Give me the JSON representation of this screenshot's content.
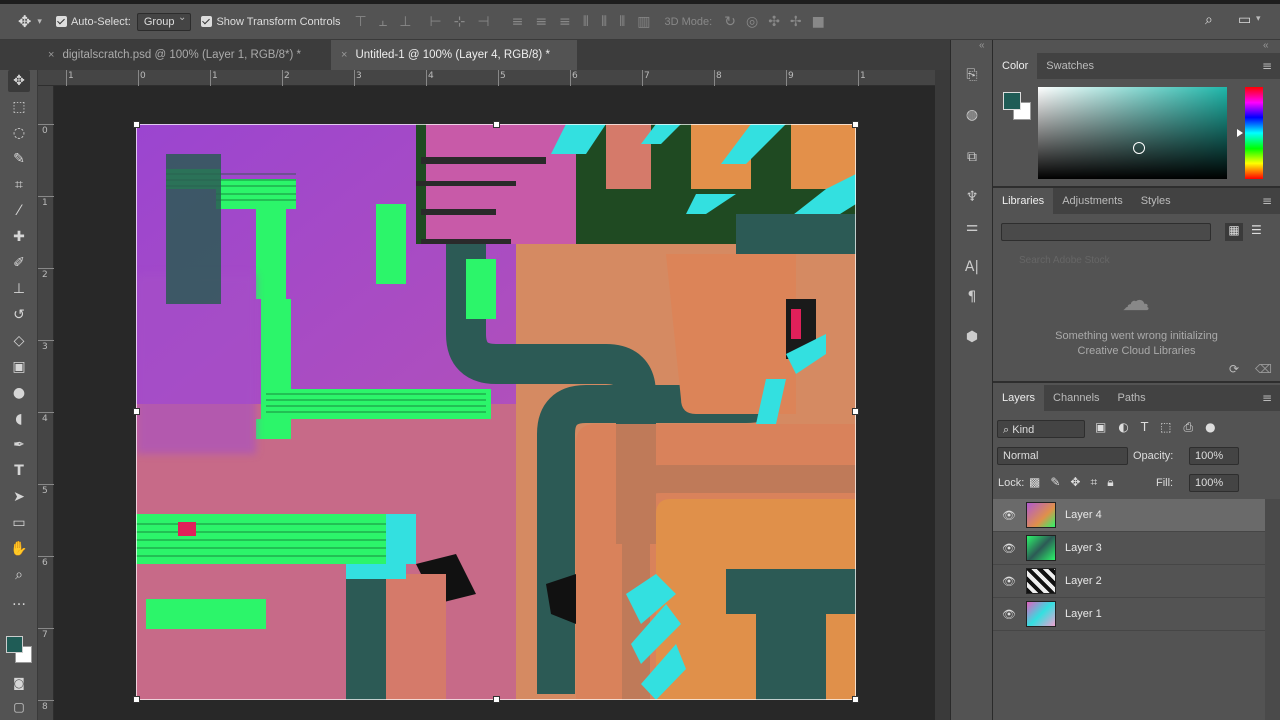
{
  "options_bar": {
    "auto_select_label": "Auto-Select:",
    "auto_select_value": "Group",
    "show_transform_label": "Show Transform Controls",
    "mode_3d_label": "3D Mode:"
  },
  "tabs": [
    {
      "label": "digitalscratch.psd @ 100% (Layer 1, RGB/8*) *",
      "active": false
    },
    {
      "label": "Untitled-1 @ 100% (Layer 4, RGB/8) *",
      "active": true
    }
  ],
  "rulers": {
    "horizontal": [
      "1",
      "0",
      "1",
      "2",
      "3",
      "4",
      "5",
      "6",
      "7",
      "8",
      "9",
      "1"
    ],
    "vertical": [
      "0",
      "1",
      "2",
      "3",
      "4",
      "5",
      "6",
      "7",
      "8"
    ]
  },
  "color_panel": {
    "tabs": [
      "Color",
      "Swatches"
    ],
    "active_tab": "Color",
    "foreground": "#1f5c56",
    "background": "#ffffff",
    "field_hue": "#1fb7aa"
  },
  "libraries_panel": {
    "tabs": [
      "Libraries",
      "Adjustments",
      "Styles"
    ],
    "active_tab": "Libraries",
    "search_placeholder": "Search Adobe Stock",
    "error_line1": "Something went wrong initializing",
    "error_line2": "Creative Cloud Libraries"
  },
  "layers_panel": {
    "tabs": [
      "Layers",
      "Channels",
      "Paths"
    ],
    "active_tab": "Layers",
    "filter_label": "Kind",
    "blend_mode": "Normal",
    "opacity_label": "Opacity:",
    "opacity_value": "100%",
    "lock_label": "Lock:",
    "fill_label": "Fill:",
    "fill_value": "100%",
    "layers": [
      {
        "name": "Layer 4",
        "selected": true
      },
      {
        "name": "Layer 3",
        "selected": false
      },
      {
        "name": "Layer 2",
        "selected": false
      },
      {
        "name": "Layer 1",
        "selected": false
      }
    ]
  },
  "artwork_colors": {
    "purple": "#9a49c6",
    "magenta": "#c85aa8",
    "salmon": "#d57a6a",
    "orange": "#e3904a",
    "teal": "#2c5a55",
    "green": "#2cf56a",
    "cyan": "#33e0e0",
    "darkgreen": "#1f4a22"
  }
}
